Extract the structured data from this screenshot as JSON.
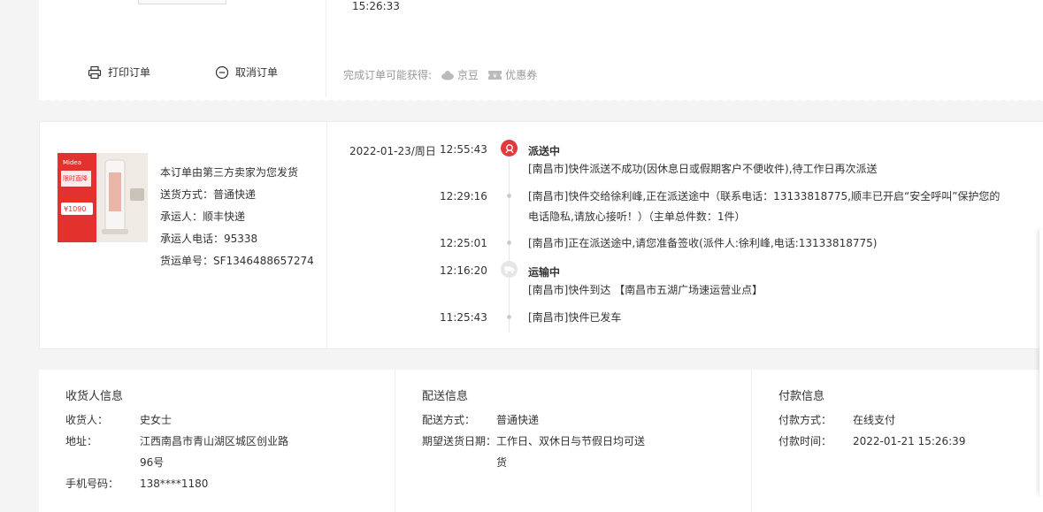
{
  "top": {
    "order_time": "15:26:33",
    "print_label": "打印订单",
    "cancel_label": "取消订单",
    "rewards_label": "完成订单可能获得:",
    "jingdou_label": "京豆",
    "coupon_label": "优惠券"
  },
  "product": {
    "badge_text": "限时直降",
    "price_text": "¥1090"
  },
  "shipping": {
    "seller_note": "本订单由第三方卖家为您发货",
    "method": "送货方式：普通快递",
    "carrier": "承运人：顺丰快递",
    "carrier_phone": "承运人电话：95338",
    "tracking_no": "货运单号：SF1346488657274"
  },
  "timeline": {
    "date": "2022-01-23/周日",
    "events": [
      {
        "time": "12:55:43",
        "status": "派送中",
        "text": "[南昌市]快件派送不成功(因休息日或假期客户不便收件),待工作日再次派送"
      },
      {
        "time": "12:29:16",
        "text": "[南昌市]快件交给徐利峰,正在派送途中（联系电话：13133818775,顺丰已开启“安全呼叫”保护您的",
        "text2": "电话隐私,请放心接听！）（主单总件数：1件）"
      },
      {
        "time": "12:25:01",
        "text": "[南昌市]正在派送途中,请您准备签收(派件人:徐利峰,电话:13133818775)"
      },
      {
        "time": "12:16:20",
        "status": "运输中",
        "text": "[南昌市]快件到达 【南昌市五湖广场速运营业点】"
      },
      {
        "time": "11:25:43",
        "text": "[南昌市]快件已发车"
      }
    ]
  },
  "consignee": {
    "title": "收货人信息",
    "name_k": "收货人：",
    "name_v": "史女士",
    "addr_k": "地址：",
    "addr_v1": "江西南昌市青山湖区城区创业路",
    "addr_v2": "96号",
    "phone_k": "手机号码：",
    "phone_v": "138****1180"
  },
  "delivery": {
    "title": "配送信息",
    "method_k": "配送方式：",
    "method_v": "普通快递",
    "date_k": "期望送货日期：",
    "date_v1": "工作日、双休日与节假日均可送",
    "date_v2": "货"
  },
  "payment": {
    "title": "付款信息",
    "method_k": "付款方式：",
    "method_v": "在线支付",
    "time_k": "付款时间：",
    "time_v": "2022-01-21 15:26:39"
  },
  "colors": {
    "accent": "#e4393c",
    "muted": "#999999"
  }
}
